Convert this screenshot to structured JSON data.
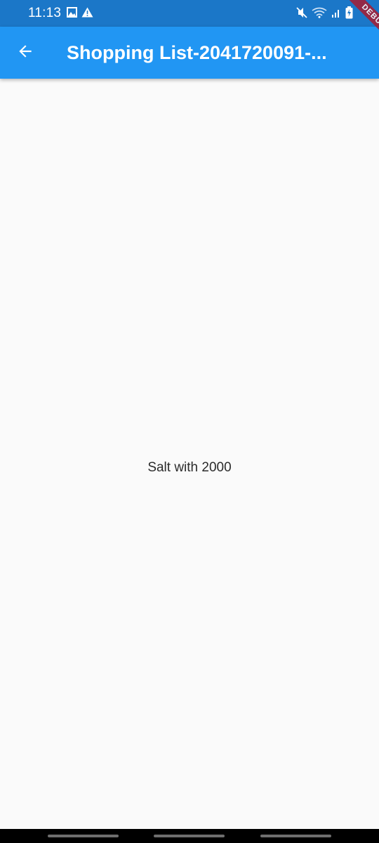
{
  "status_bar": {
    "time": "11:13",
    "left_icons": [
      "image-icon",
      "warning-icon"
    ],
    "right_icons": [
      "mute-icon",
      "wifi-icon",
      "signal-icon",
      "battery-charging-icon"
    ],
    "background": "#1b77c8"
  },
  "app_bar": {
    "title": "Shopping List-2041720091-...",
    "back_icon": "arrow-back-icon",
    "background": "#2196f3"
  },
  "debug_banner": {
    "label": "DEBUG"
  },
  "main": {
    "message": "Salt with 2000"
  },
  "nav_bar": {
    "buttons": [
      "recent-apps-button",
      "home-button",
      "back-nav-button"
    ]
  }
}
